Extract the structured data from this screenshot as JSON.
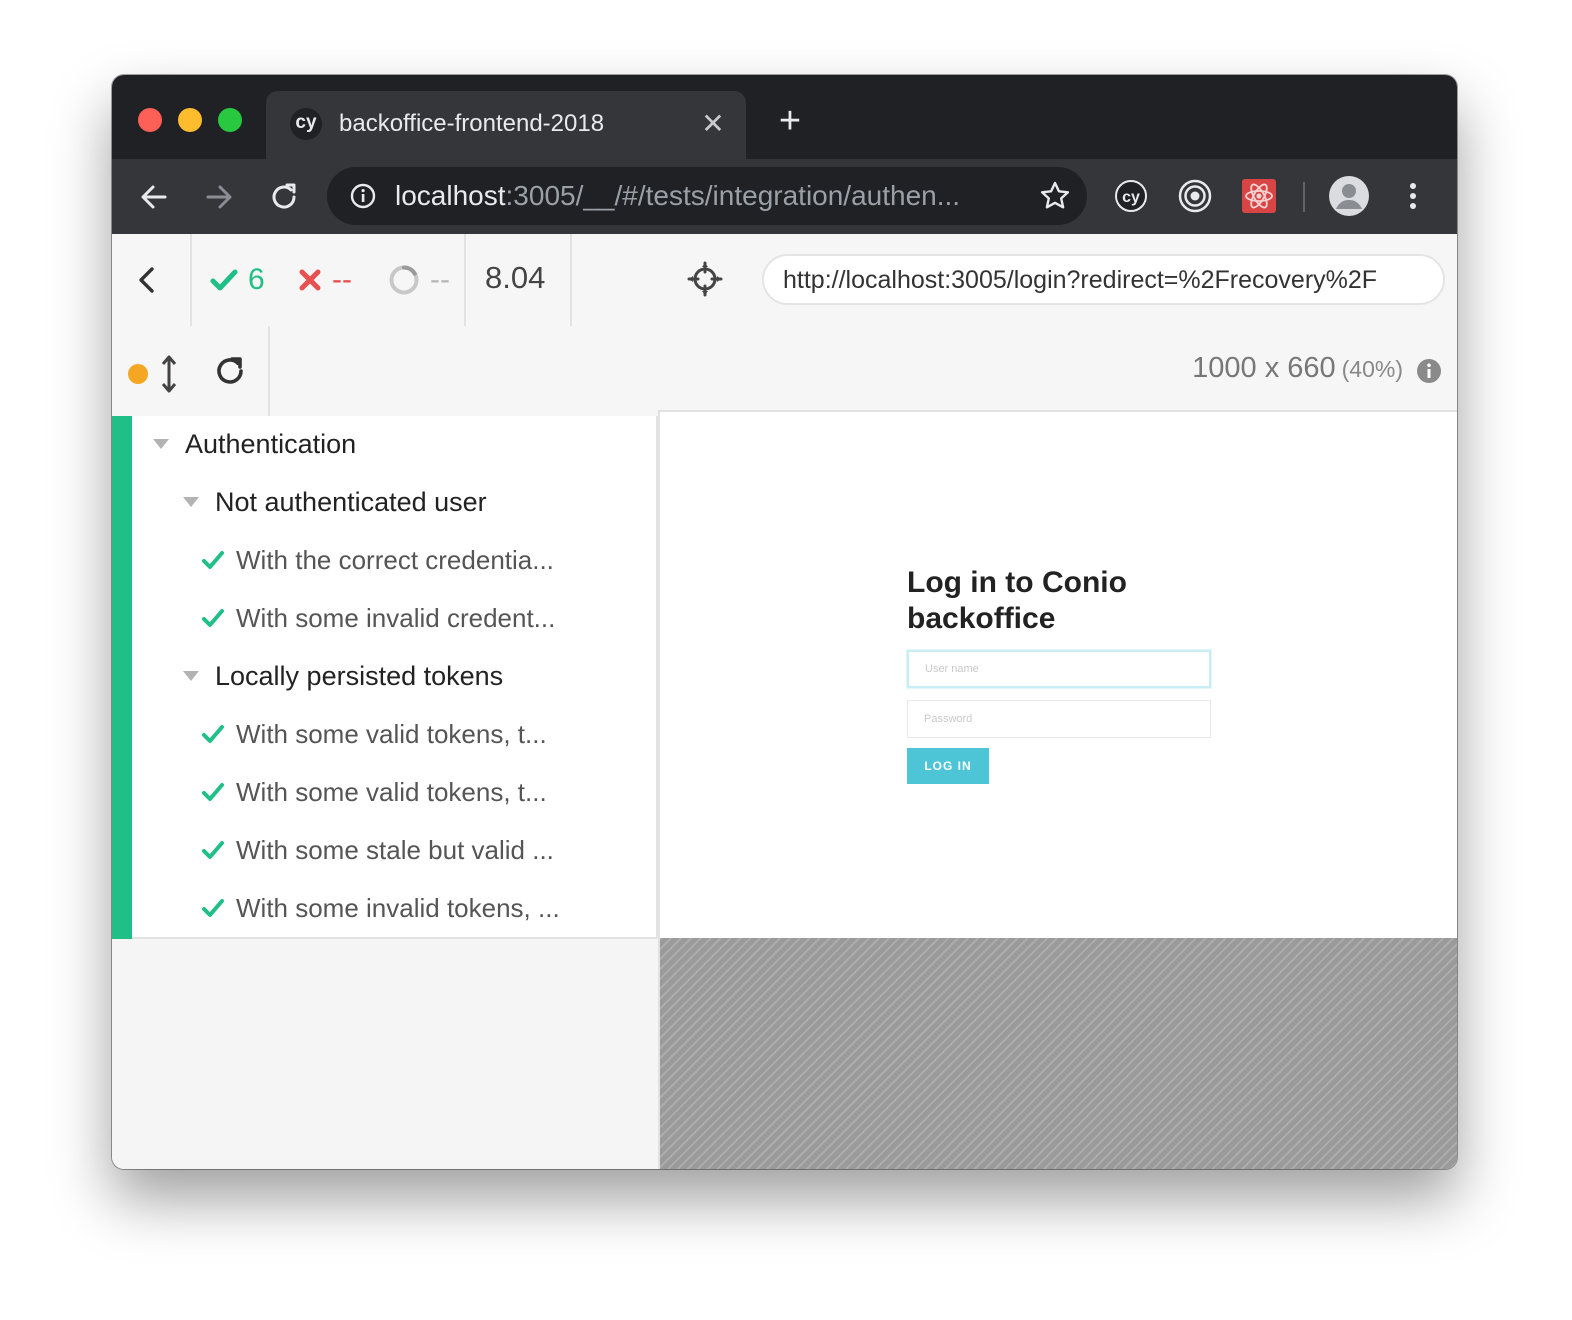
{
  "browser": {
    "tab": {
      "favicon": "cy",
      "title": "backoffice-frontend-2018"
    },
    "address_bar": {
      "host": "localhost",
      "rest": ":3005/__/#/tests/integration/authen..."
    },
    "icons": [
      "back-arrow-icon",
      "forward-arrow-icon",
      "reload-icon",
      "info-icon",
      "star-icon",
      "cypress-extension-icon",
      "target-extension-icon",
      "react-devtools-icon",
      "profile-avatar-icon",
      "more-menu-icon"
    ]
  },
  "cypress": {
    "stats": {
      "passed": "6",
      "failed": "--",
      "pending": "--"
    },
    "duration": "8.04",
    "aut_url": "http://localhost:3005/login?redirect=%2Frecovery%2F",
    "viewport": {
      "size": "1000 x 660",
      "scale": "(40%)"
    },
    "status_color": "#f5a623",
    "pass_color": "#1fbf87",
    "fail_color": "#e94f4f"
  },
  "reporter": {
    "root_suite": "Authentication",
    "suites": [
      {
        "title": "Not authenticated user",
        "tests": [
          "With the correct credentia...",
          "With some invalid credent..."
        ]
      },
      {
        "title": "Locally persisted tokens",
        "tests": [
          "With some valid tokens, t...",
          "With some valid tokens, t...",
          "With some stale but valid ...",
          "With some invalid tokens, ..."
        ]
      }
    ]
  },
  "app": {
    "login_title": "Log in to Conio backoffice",
    "username_placeholder": "User name",
    "password_placeholder": "Password",
    "login_button": "LOG IN",
    "accent_color": "#4dc5d7"
  }
}
